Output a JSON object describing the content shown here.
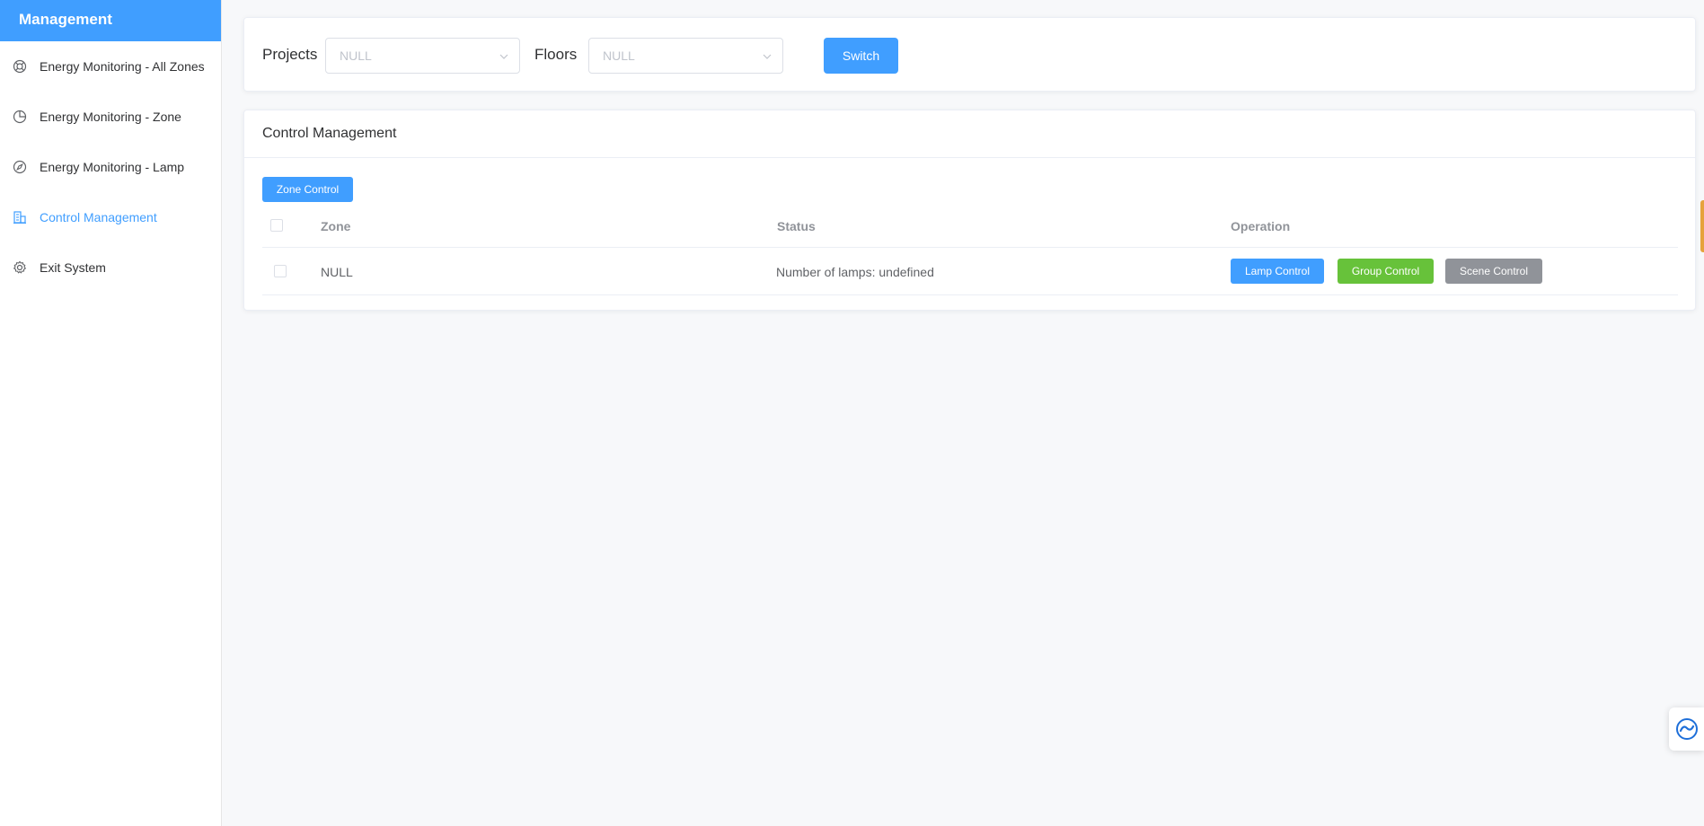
{
  "sidebar": {
    "title": "Management",
    "items": [
      {
        "label": "Energy Monitoring - All Zones",
        "icon": "ring-icon"
      },
      {
        "label": "Energy Monitoring - Zone",
        "icon": "pie-chart-icon"
      },
      {
        "label": "Energy Monitoring - Lamp",
        "icon": "compass-icon"
      },
      {
        "label": "Control Management",
        "icon": "building-icon",
        "active": true
      },
      {
        "label": "Exit System",
        "icon": "gear-icon"
      }
    ]
  },
  "filter": {
    "projects_label": "Projects",
    "projects_value": "NULL",
    "floors_label": "Floors",
    "floors_value": "NULL",
    "switch_label": "Switch"
  },
  "control": {
    "title": "Control Management",
    "zone_control_label": "Zone Control",
    "columns": [
      "Zone",
      "Status",
      "Operation"
    ],
    "rows": [
      {
        "zone": "NULL",
        "status": "Number of lamps: undefined",
        "lamp_control": "Lamp Control",
        "group_control": "Group Control",
        "scene_control": "Scene Control"
      }
    ]
  },
  "colors": {
    "primary": "#409eff",
    "success": "#67c23a",
    "info": "#909399"
  }
}
